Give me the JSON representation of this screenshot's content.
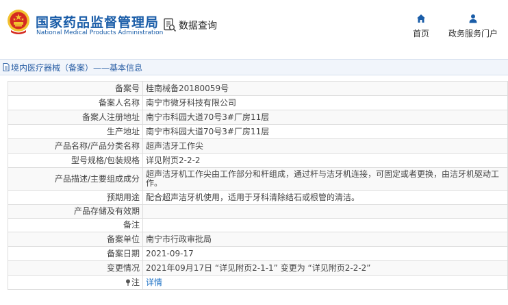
{
  "header": {
    "site_title": "国家药品监督管理局",
    "site_subtitle": "National Medical Products Administration",
    "data_query_label": "数据查询",
    "nav": {
      "home_label": "首页",
      "gov_portal_label": "政务服务门户"
    }
  },
  "breadcrumb": {
    "text": "境内医疗器械（备案）——基本信息"
  },
  "record": {
    "rows": [
      {
        "label": "备案号",
        "value": "桂南械备20180059号"
      },
      {
        "label": "备案人名称",
        "value": "南宁市微牙科技有限公司"
      },
      {
        "label": "备案人注册地址",
        "value": "南宁市科园大道70号3#厂房11层"
      },
      {
        "label": "生产地址",
        "value": "南宁市科园大道70号3#厂房11层"
      },
      {
        "label": "产品名称/产品分类名称",
        "value": "超声洁牙工作尖"
      },
      {
        "label": "型号规格/包装规格",
        "value": "详见附页2-2-2"
      },
      {
        "label": "产品描述/主要组成成分",
        "value": "超声洁牙机工作尖由工作部分和杆组成，通过杆与洁牙机连接，可固定或者更换，由洁牙机驱动工作。"
      },
      {
        "label": "预期用途",
        "value": "配合超声洁牙机使用，适用于牙科清除结石或根管的清洁。"
      },
      {
        "label": "产品存储及有效期",
        "value": ""
      },
      {
        "label": "备注",
        "value": ""
      },
      {
        "label": "备案单位",
        "value": "南宁市行政审批局"
      },
      {
        "label": "备案日期",
        "value": "2021-09-17"
      },
      {
        "label": "变更情况",
        "value": "2021年09月17日 “详见附页2-1-1” 变更为 “详见附页2-2-2”"
      },
      {
        "label": "注",
        "value": "详情"
      }
    ]
  },
  "colors": {
    "brand_blue": "#1a5da8",
    "emblem_red": "#d42a20",
    "emblem_gold": "#f2c230",
    "link_blue": "#1a6fc4"
  },
  "icons": [
    "national-emblem-icon",
    "data-query-icon",
    "home-icon",
    "user-icon",
    "document-icon",
    "pin-icon"
  ]
}
